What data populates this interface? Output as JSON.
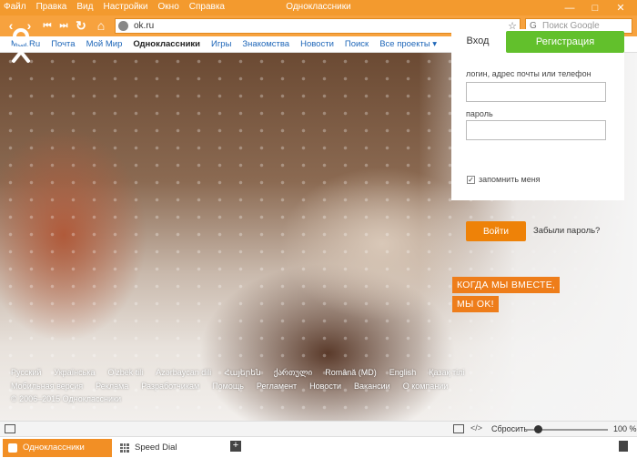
{
  "menu": [
    "Файл",
    "Правка",
    "Вид",
    "Настройки",
    "Окно",
    "Справка"
  ],
  "window_title": "Одноклассники",
  "window_controls": [
    "—",
    "□",
    "✕"
  ],
  "nav": {
    "back": "‹",
    "forward": "›",
    "rewind": "⏮",
    "ffwd": "⏭",
    "reload": "↻",
    "home": "⌂",
    "url": "ok.ru",
    "bookmark": "☆",
    "search_placeholder": "Поиск Google",
    "search_engine": "G"
  },
  "site_links": [
    "Mail.Ru",
    "Почта",
    "Мой Мир",
    "Одноклассники",
    "Игры",
    "Знакомства",
    "Новости",
    "Поиск",
    "Все проекты ▾"
  ],
  "site_links_active": "Одноклассники",
  "login": {
    "tab_login": "Вход",
    "tab_register": "Регистрация",
    "login_label": "логин, адрес почты или телефон",
    "password_label": "пароль",
    "remember": "запомнить меня",
    "remember_checked": true,
    "submit": "Войти",
    "forgot": "Забыли пароль?"
  },
  "tagline": [
    "КОГДА МЫ ВМЕСТЕ,",
    "МЫ OK!"
  ],
  "footer": {
    "languages": [
      "Русский",
      "Українська",
      "O'zbek tili",
      "Azərbaycan dili",
      "Հայերեն",
      "ქართული",
      "Română (MD)",
      "English",
      "Қазақ тілі"
    ],
    "links": [
      "Мобильная версия",
      "Реклама",
      "Разработчикам",
      "Помощь",
      "Регламент",
      "Новости",
      "Вакансии",
      "О компании"
    ],
    "copyright": "© 2006–2015 Одноклассники"
  },
  "status": {
    "reset": "Сбросить",
    "zoom": "100 %",
    "code_icon": "</>"
  },
  "tabs": [
    {
      "title": "Одноклассники",
      "active": true
    },
    {
      "title": "Speed Dial",
      "active": false
    }
  ],
  "new_tab": "+",
  "colors": {
    "brand_orange": "#f39a2e",
    "register_green": "#62c02c",
    "login_button": "#ee8208",
    "link_blue": "#1e66b8"
  }
}
